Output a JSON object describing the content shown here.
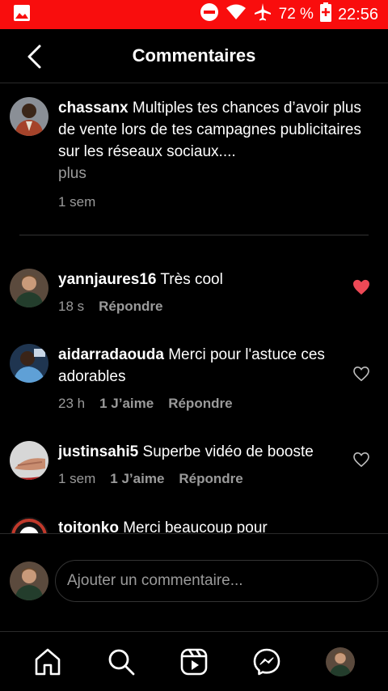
{
  "status_bar": {
    "battery": "72 %",
    "time": "22:56"
  },
  "header": {
    "title": "Commentaires"
  },
  "caption": {
    "username": "chassanx",
    "text": "Multiples tes chances d’avoir plus de vente lors de tes campagnes publicitaires sur les réseaux sociaux....",
    "more": "plus",
    "time": "1 sem"
  },
  "comments": [
    {
      "username": "yannjaures16",
      "text": "Très cool",
      "time": "18 s",
      "likes": "",
      "reply": "Répondre",
      "liked": true
    },
    {
      "username": "aidarradaouda",
      "text": "Merci pour l'astuce ces adorables",
      "time": "23 h",
      "likes": "1 J’aime",
      "reply": "Répondre",
      "liked": false
    },
    {
      "username": "justinsahi5",
      "text": "Superbe vidéo de booste",
      "time": "1 sem",
      "likes": "1 J’aime",
      "reply": "Répondre",
      "liked": false
    },
    {
      "username": "toitonko",
      "text": "Merci beaucoup pour"
    }
  ],
  "composer": {
    "placeholder": "Ajouter un commentaire..."
  },
  "colors": {
    "accent_like": "#ed4956",
    "status_bar": "#f90d0d",
    "muted": "#9a9a9a"
  },
  "icons": [
    "gallery-icon",
    "dnd-icon",
    "wifi-icon",
    "airplane-icon",
    "battery-icon",
    "back-icon",
    "heart-icon",
    "home-icon",
    "search-icon",
    "reels-icon",
    "messenger-icon"
  ]
}
